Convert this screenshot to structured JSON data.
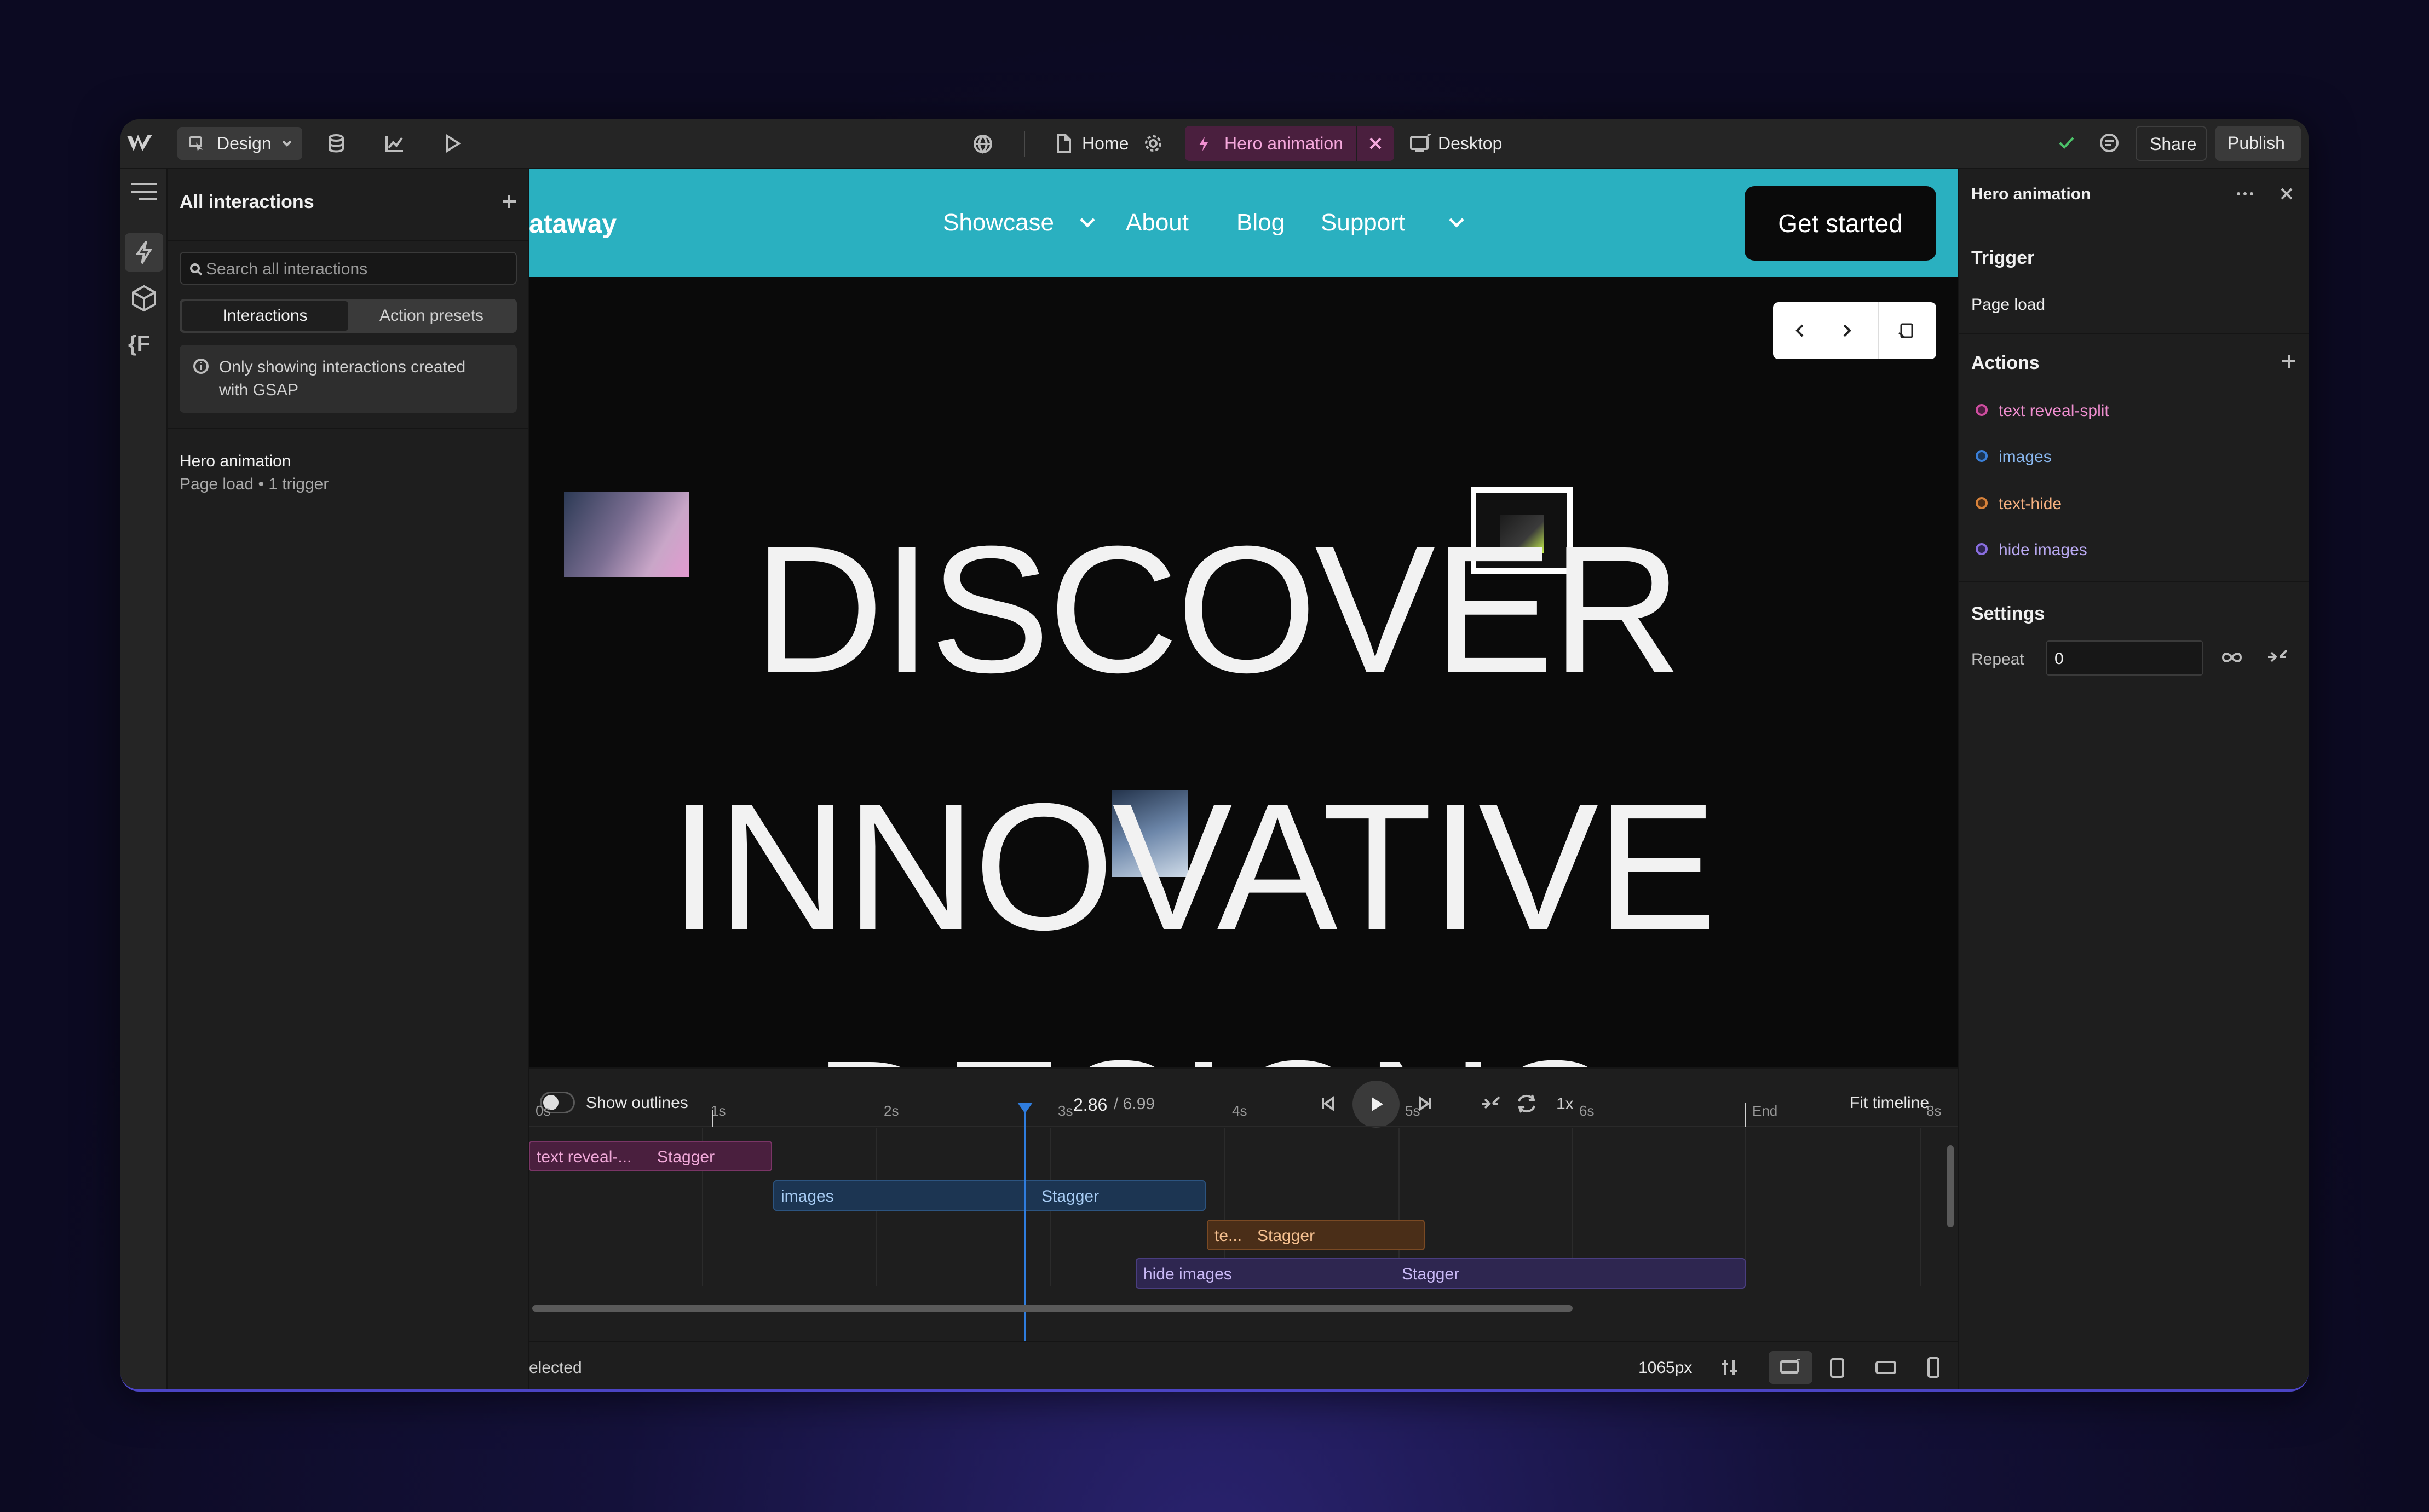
{
  "topbar": {
    "mode_label": "Design",
    "page_label": "Home",
    "interaction_tab_label": "Hero animation",
    "breakpoint_label": "Desktop",
    "share_label": "Share",
    "publish_label": "Publish"
  },
  "left_panel": {
    "title": "All interactions",
    "search_placeholder": "Search all interactions",
    "tabs": [
      "Interactions",
      "Action presets"
    ],
    "info_line1": "Only showing interactions created",
    "info_line2": "with GSAP",
    "interaction_name": "Hero animation",
    "interaction_meta": "Page load • 1 trigger"
  },
  "canvas": {
    "brand_fragment": "ataway",
    "nav": [
      "Showcase",
      "About",
      "Blog",
      "Support"
    ],
    "cta": "Get started",
    "hero_words": [
      "DISCOVER",
      "INNOVATIVE",
      "DESIGNS"
    ]
  },
  "right_panel": {
    "title": "Hero animation",
    "trigger_heading": "Trigger",
    "trigger_value": "Page load",
    "actions_heading": "Actions",
    "actions": [
      {
        "label": "text reveal-split",
        "color": "#d04ea0"
      },
      {
        "label": "images",
        "color": "#3a7fd8"
      },
      {
        "label": "text-hide",
        "color": "#d8823a"
      },
      {
        "label": "hide images",
        "color": "#8a6ee0"
      }
    ],
    "settings_heading": "Settings",
    "repeat_label": "Repeat",
    "repeat_value": "0"
  },
  "timeline": {
    "show_outlines_label": "Show outlines",
    "time_current": "2.86",
    "time_total": "/ 6.99",
    "speed": "1x",
    "fit_label": "Fit timeline",
    "ticks": [
      "0s",
      "1s",
      "2s",
      "3s",
      "4s",
      "5s",
      "6s",
      "End",
      "8s"
    ],
    "tracks": [
      {
        "name": "text reveal-...",
        "stagger": "Stagger"
      },
      {
        "name": "images",
        "stagger": "Stagger"
      },
      {
        "name": "te...",
        "stagger": "Stagger"
      },
      {
        "name": "hide images",
        "stagger": "Stagger"
      }
    ]
  },
  "statusbar": {
    "selection_text": "elected",
    "width_text": "1065px"
  }
}
